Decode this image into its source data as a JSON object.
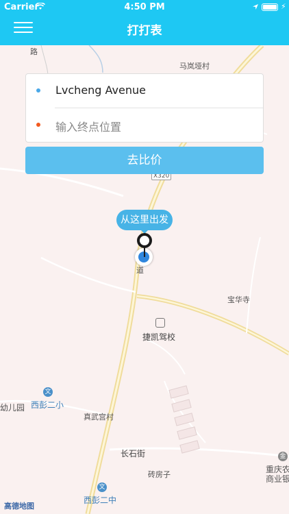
{
  "status_bar": {
    "carrier": "Carrier",
    "time": "4:50 PM",
    "battery_level": 1.0
  },
  "nav": {
    "title": "打打表",
    "menu_icon": "hamburger-menu-icon"
  },
  "route": {
    "start_value": "Lvcheng Avenue",
    "end_placeholder": "输入终点位置",
    "start_dot_color": "#4aa8e8",
    "end_dot_color": "#f25a1f"
  },
  "compare_button": "去比价",
  "pickup_bubble": "从这里出发",
  "colors": {
    "accent": "#1ec8f3",
    "button": "#5bbfee",
    "bubble": "#47b3e6"
  },
  "map": {
    "provider_logo": "高德地图",
    "labels": {
      "road_fragment": "路",
      "village_malan": "马岚垭村",
      "road_code": "X320",
      "dao": "道",
      "baohua_temple": "宝华寺",
      "driving_school": "捷凯驾校",
      "kindergarten": "幼儿园",
      "xipeng_two_primary": "西彭二小",
      "zhenwugong_village": "真武宫村",
      "changshi_street": "长石街",
      "zhuanfangzi": "砖房子",
      "xipeng_two_middle": "西彭二中",
      "bank_line1": "重庆农",
      "bank_line2": "商业银",
      "school_glyph": "文",
      "bank_glyph": "金"
    }
  }
}
